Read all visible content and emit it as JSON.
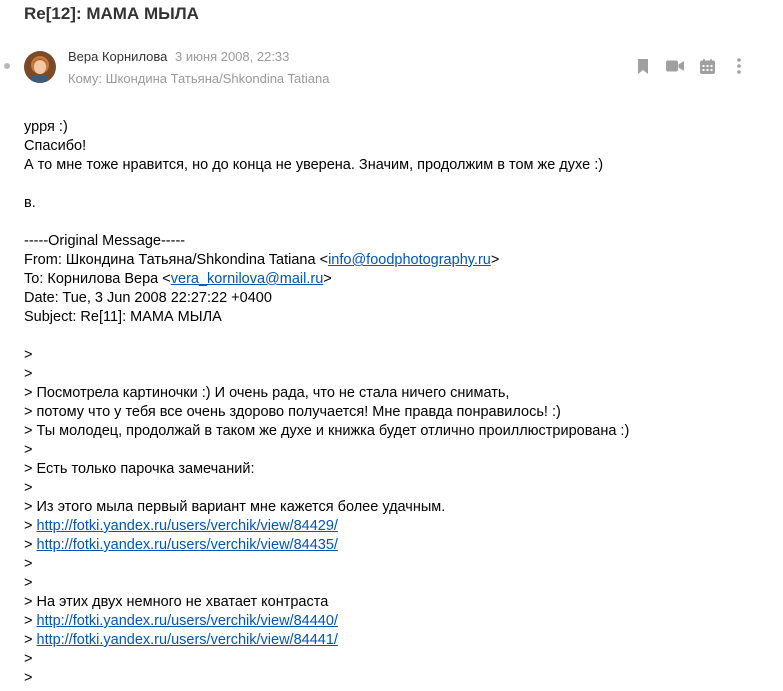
{
  "header": {
    "subject": "Re[12]: МАМА МЫЛА"
  },
  "message": {
    "sender_name": "Вера Корнилова",
    "sent_date": "3 июня 2008, 22:33",
    "to_line": "Кому: Шкондина Татьяна/Shkondina Tatiana"
  },
  "icons": {
    "bookmark": "bookmark-icon",
    "video": "video-camera-icon",
    "calendar": "calendar-icon",
    "more": "more-vertical-icon"
  },
  "colors": {
    "link": "#0055bb",
    "meta": "#999999",
    "icon": "#a0a0a0"
  },
  "body": {
    "lines": [
      {
        "text": "урря :)"
      },
      {
        "text": "Спасибо!"
      },
      {
        "text": "А то мне тоже нравится, но до конца не уверена. Значим, продолжим в том же духе :)"
      },
      {
        "text": ""
      },
      {
        "text": "в."
      },
      {
        "text": ""
      },
      {
        "text": "-----Original Message-----"
      },
      {
        "text": "From: Шкондина Татьяна/Shkondina Tatiana <",
        "link": "info@foodphotography.ru",
        "after": ">"
      },
      {
        "text": "To: Корнилова Вера <",
        "link": "vera_kornilova@mail.ru",
        "after": ">"
      },
      {
        "text": "Date: Tue, 3 Jun 2008 22:27:22 +0400"
      },
      {
        "text": "Subject: Re[11]: МАМА МЫЛА"
      },
      {
        "text": ""
      },
      {
        "text": ">"
      },
      {
        "text": ">"
      },
      {
        "text": "> Посмотрела картиночки :) И очень рада, что не стала ничего снимать,"
      },
      {
        "text": "> потому что у тебя все очень здорово получается! Мне правда понравилось! :)"
      },
      {
        "text": "> Ты молодец, продолжай в таком же духе и книжка будет отлично проиллюстрирована :)"
      },
      {
        "text": ">"
      },
      {
        "text": "> Есть только парочка замечаний:"
      },
      {
        "text": ">"
      },
      {
        "text": "> Из этого мыла первый вариант мне кажется более удачным."
      },
      {
        "text": "> ",
        "link": "http://fotki.yandex.ru/users/verchik/view/84429/",
        "after": ""
      },
      {
        "text": "> ",
        "link": "http://fotki.yandex.ru/users/verchik/view/84435/",
        "after": ""
      },
      {
        "text": ">"
      },
      {
        "text": ">"
      },
      {
        "text": "> На этих двух немного не хватает контраста"
      },
      {
        "text": "> ",
        "link": "http://fotki.yandex.ru/users/verchik/view/84440/",
        "after": ""
      },
      {
        "text": "> ",
        "link": "http://fotki.yandex.ru/users/verchik/view/84441/",
        "after": ""
      },
      {
        "text": ">"
      },
      {
        "text": ">"
      }
    ]
  }
}
